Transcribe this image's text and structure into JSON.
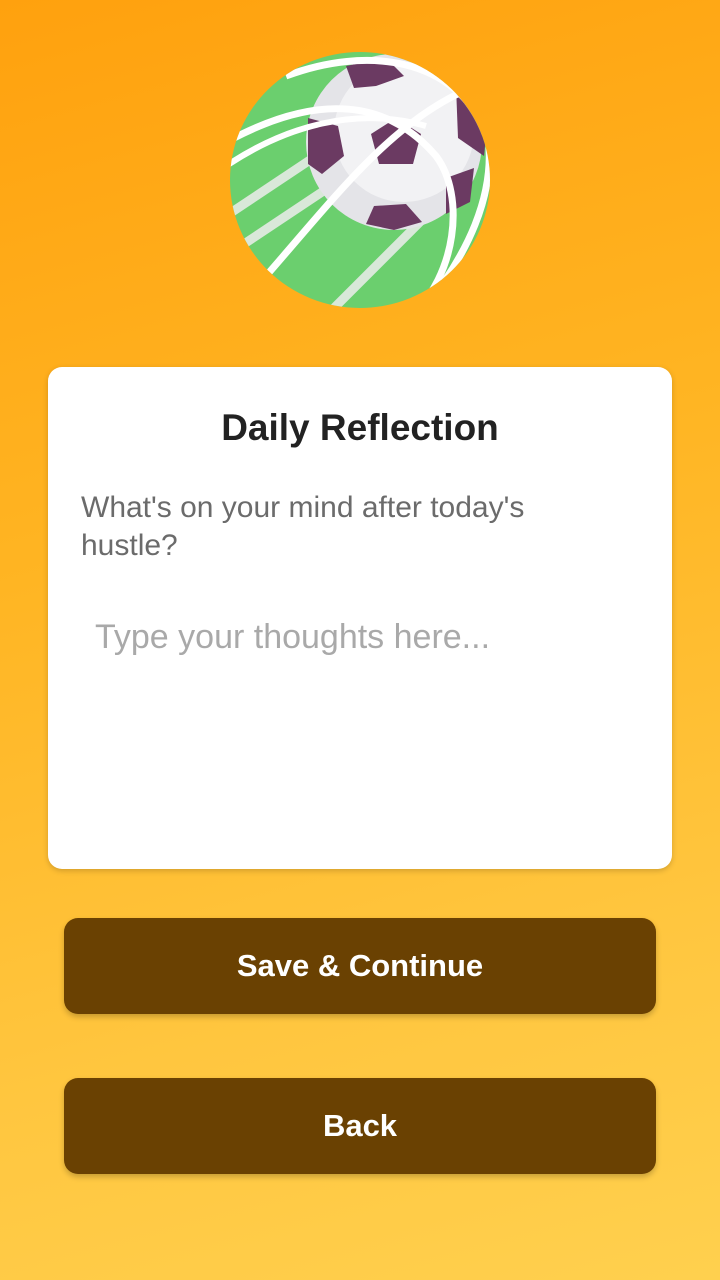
{
  "header": {
    "logo_icon": "soccer-ball-icon"
  },
  "card": {
    "title": "Daily Reflection",
    "prompt": "What's on your mind after today's hustle?",
    "input_placeholder": "Type your thoughts here...",
    "input_value": ""
  },
  "actions": {
    "save_label": "Save & Continue",
    "back_label": "Back"
  },
  "colors": {
    "background_top": "#FFA10E",
    "background_bottom": "#FFD04E",
    "button": "#6A4102",
    "field_green": "#6BCF6E",
    "ball_patch": "#6B3A62"
  }
}
